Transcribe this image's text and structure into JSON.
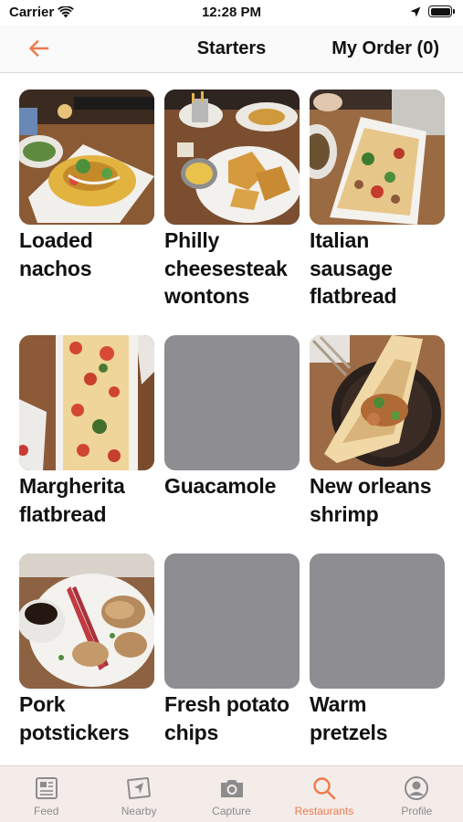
{
  "status": {
    "carrier": "Carrier",
    "time": "12:28 PM"
  },
  "nav": {
    "title": "Starters",
    "order": "My Order (0)"
  },
  "accent_color": "#ee7a4c",
  "items": [
    {
      "label": "Loaded nachos",
      "image": "photo"
    },
    {
      "label": "Philly cheesesteak wontons",
      "image": "photo"
    },
    {
      "label": "Italian sausage flatbread",
      "image": "photo"
    },
    {
      "label": "Margherita flatbread",
      "image": "photo"
    },
    {
      "label": "Guacamole",
      "image": "placeholder"
    },
    {
      "label": "New orleans shrimp",
      "image": "photo"
    },
    {
      "label": "Pork potstickers",
      "image": "photo"
    },
    {
      "label": "Fresh potato chips",
      "image": "placeholder"
    },
    {
      "label": "Warm pretzels",
      "image": "placeholder"
    }
  ],
  "tabs": [
    {
      "label": "Feed",
      "icon": "feed-icon",
      "active": false
    },
    {
      "label": "Nearby",
      "icon": "nearby-icon",
      "active": false
    },
    {
      "label": "Capture",
      "icon": "camera-icon",
      "active": false
    },
    {
      "label": "Restaurants",
      "icon": "search-icon",
      "active": true
    },
    {
      "label": "Profile",
      "icon": "profile-icon",
      "active": false
    }
  ]
}
